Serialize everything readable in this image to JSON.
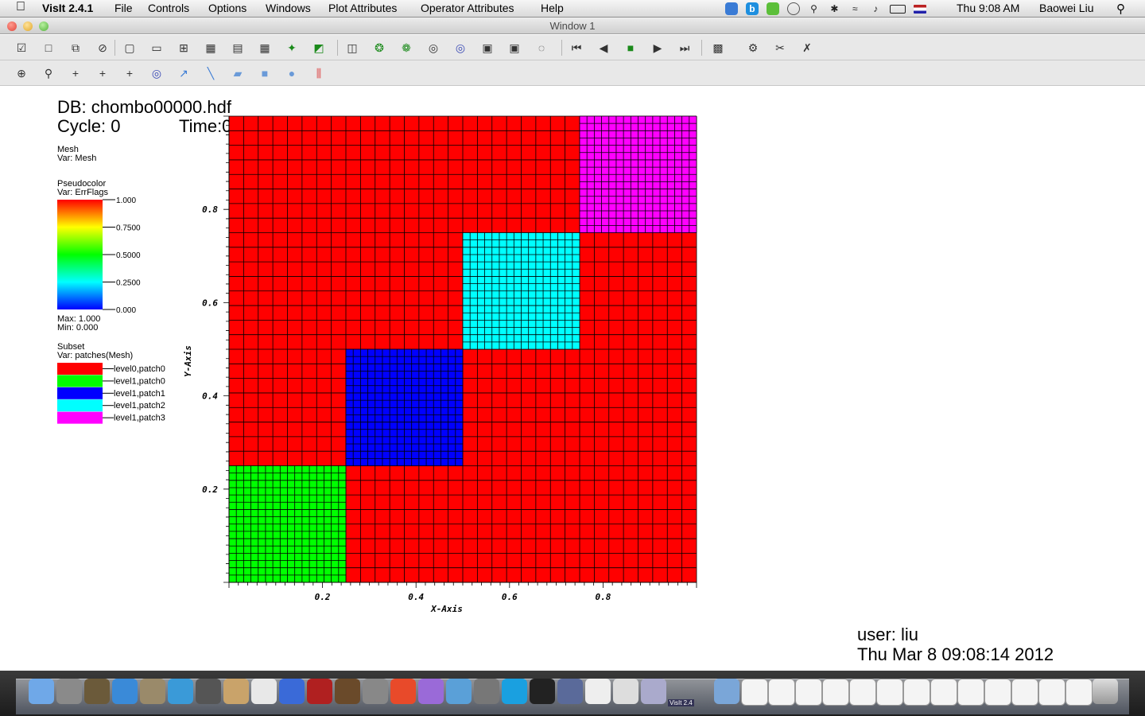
{
  "menubar": {
    "apple_icon": "apple-logo",
    "app_name": "VisIt 2.4.1",
    "items": [
      "File",
      "Controls",
      "Options",
      "Windows",
      "Plot Attributes",
      "Operator Attributes",
      "Help"
    ],
    "clock": "Thu 9:08 AM",
    "user": "Baowei Liu"
  },
  "window": {
    "title": "Window 1"
  },
  "annotations": {
    "db": "DB: chombo00000.hdf",
    "cycle": "Cycle: 0",
    "time": "Time:0",
    "user": "user: liu",
    "date": "Thu Mar  8 09:08:14 2012"
  },
  "legend": {
    "mesh": {
      "title": "Mesh",
      "var": "Var: Mesh"
    },
    "pseudocolor": {
      "title": "Pseudocolor",
      "var": "Var: ErrFlags",
      "ticks": [
        "1.000",
        "0.7500",
        "0.5000",
        "0.2500",
        "0.000"
      ],
      "max": "Max:  1.000",
      "min": "Min:  0.000"
    },
    "subset": {
      "title": "Subset",
      "var": "Var: patches(Mesh)",
      "entries": [
        {
          "label": "level0,patch0",
          "color": "#ff0000"
        },
        {
          "label": "level1,patch0",
          "color": "#00ff00"
        },
        {
          "label": "level1,patch1",
          "color": "#0000ff"
        },
        {
          "label": "level1,patch2",
          "color": "#00ffff"
        },
        {
          "label": "level1,patch3",
          "color": "#ff00ff"
        }
      ]
    }
  },
  "chart_data": {
    "type": "heatmap",
    "xlabel": "X-Axis",
    "ylabel": "Y-Axis",
    "xlim": [
      0,
      1
    ],
    "ylim": [
      0,
      1
    ],
    "xticks": [
      "0.2",
      "0.4",
      "0.6",
      "0.8"
    ],
    "yticks": [
      "0.2",
      "0.4",
      "0.6",
      "0.8"
    ],
    "base_patch": {
      "name": "level0,patch0",
      "x": [
        0,
        1
      ],
      "y": [
        0,
        1
      ],
      "cells": 32,
      "color": "#ff0000"
    },
    "patches": [
      {
        "name": "level1,patch0",
        "x": [
          0,
          0.25
        ],
        "y": [
          0,
          0.25
        ],
        "cells": 16,
        "color": "#00ff00"
      },
      {
        "name": "level1,patch1",
        "x": [
          0.25,
          0.5
        ],
        "y": [
          0.25,
          0.5
        ],
        "cells": 16,
        "color": "#0000ff"
      },
      {
        "name": "level1,patch2",
        "x": [
          0.5,
          0.75
        ],
        "y": [
          0.5,
          0.75
        ],
        "cells": 16,
        "color": "#00ffff"
      },
      {
        "name": "level1,patch3",
        "x": [
          0.75,
          1
        ],
        "y": [
          0.75,
          1
        ],
        "cells": 16,
        "color": "#ff00ff"
      }
    ]
  },
  "toolbar1_icons": [
    "apply-icon",
    "new-window-icon",
    "clone-window-icon",
    "delete-window-icon",
    "layout-1x1-icon",
    "layout-1x2-icon",
    "layout-2x2-icon",
    "layout-2x3-icon",
    "layout-2x4-icon",
    "layout-3x3-icon",
    "lock-view-icon",
    "lock-time-icon",
    "invert-background-icon",
    "spin-icon",
    "redraw-icon",
    "pick-icon",
    "lineout-icon",
    "save-image-icon",
    "camera-icon",
    "reset-view-icon",
    "first-frame-icon",
    "prev-frame-icon",
    "stop-icon",
    "play-icon",
    "next-frame-icon",
    "palette-icon",
    "engine-icon",
    "copy-icon",
    "clear-icon"
  ],
  "toolbar2_icons": [
    "navigate-icon",
    "zoom-icon",
    "zone-pick-icon",
    "node-pick-icon",
    "spreadsheet-pick-icon",
    "lineout-icon",
    "point-tool-icon",
    "line-tool-icon",
    "plane-tool-icon",
    "box-tool-icon",
    "sphere-tool-icon",
    "axis-restriction-icon"
  ],
  "dock_icons": [
    "finder-icon",
    "launchpad-icon",
    "photo-icon",
    "app-store-icon",
    "preview-icon",
    "safari-icon",
    "facetime-icon",
    "contacts-icon",
    "calendar-icon",
    "itunes-icon",
    "photo-booth-icon",
    "iphoto-icon",
    "system-preferences-icon",
    "chrome-icon",
    "eclipse-icon",
    "ldap-icon",
    "utilities-icon",
    "skype-icon",
    "terminal-icon",
    "image-capture-icon",
    "x11-icon",
    "textedit-icon",
    "visit-icon",
    "documents-folder-icon",
    "file-icon",
    "file-icon",
    "file-icon",
    "file-icon",
    "file-icon",
    "file-icon",
    "file-icon",
    "file-icon",
    "file-icon",
    "file-icon",
    "file-icon",
    "file-icon",
    "file-icon",
    "trash-icon"
  ],
  "dock_visit_label": "VisIt 2.4"
}
